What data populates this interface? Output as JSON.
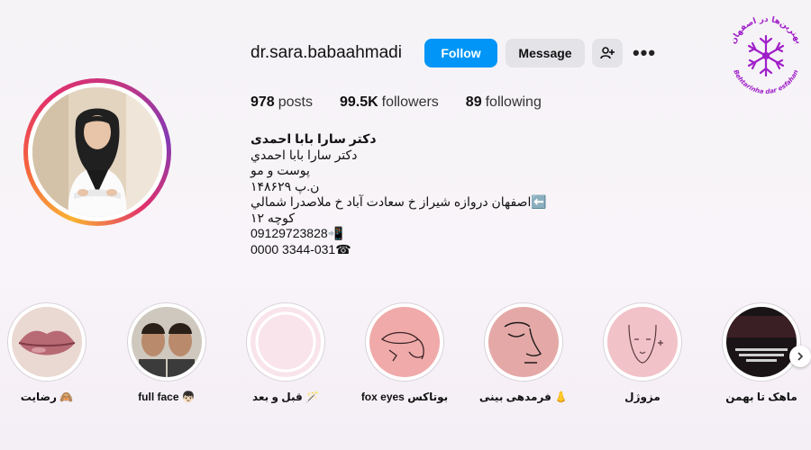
{
  "profile": {
    "username": "dr.sara.babaahmadi",
    "follow_label": "Follow",
    "message_label": "Message",
    "more_label": "•••"
  },
  "stats": {
    "posts_count": "978",
    "posts_label": "posts",
    "followers_count": "99.5K",
    "followers_label": "followers",
    "following_count": "89",
    "following_label": "following"
  },
  "bio": {
    "name": "دکتر سارا بابا احمدی",
    "lines": [
      "دکتر سارا بابا احمدي",
      "پوست و مو",
      "ن.پ ۱۴۸۶۲۹",
      "⬅️اصفهان دروازه شیراز خ سعادت آباد خ ملاصدرا شمالي",
      "کوچه ۱۲",
      "09129723828📲",
      "0000 3344-031☎"
    ]
  },
  "watermark": {
    "text_top": "بهترین‌ها در اصفهان",
    "text_bottom": "Behtarinha dar esfahan",
    "color": "#a020c8"
  },
  "highlights": [
    {
      "label": "رضایت 🙈",
      "icon": "lips-photo"
    },
    {
      "label": "full face 👦🏻",
      "icon": "twins-photo"
    },
    {
      "label": "قبل و بعد 🪄",
      "icon": "blank-pink"
    },
    {
      "label": "fox eyes بوتاکس",
      "icon": "eye-lineart"
    },
    {
      "label": "فرمدهی بینی 👃",
      "icon": "nose-lineart"
    },
    {
      "label": "مزوژل",
      "icon": "face-lineart"
    },
    {
      "label": "ماهک تا بهمن",
      "icon": "dark-video"
    }
  ],
  "colors": {
    "follow_button": "#0095f6",
    "secondary_button": "#e3e3e8",
    "highlight_pink": "#f3c6c6"
  }
}
